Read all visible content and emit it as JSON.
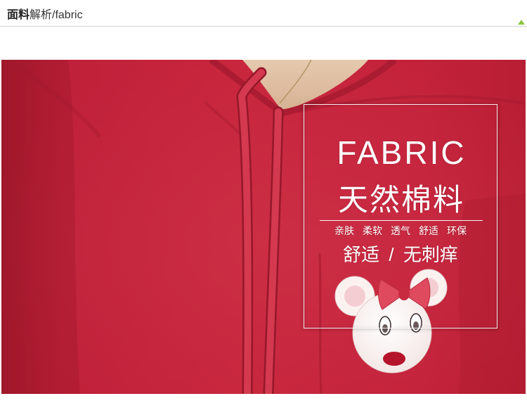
{
  "header": {
    "title_bold": "面料",
    "title_rest": "解析/fabric"
  },
  "overlay": {
    "heading": "FABRIC",
    "subheading": "天然棉料",
    "features": [
      "亲肤",
      "柔软",
      "透气",
      "舒适",
      "环保"
    ],
    "tagline": "舒适 / 无刺痒"
  },
  "colors": {
    "accent_green": "#8cc63f",
    "fabric_red": "#c4233a",
    "overlay_text": "#ffffff"
  }
}
